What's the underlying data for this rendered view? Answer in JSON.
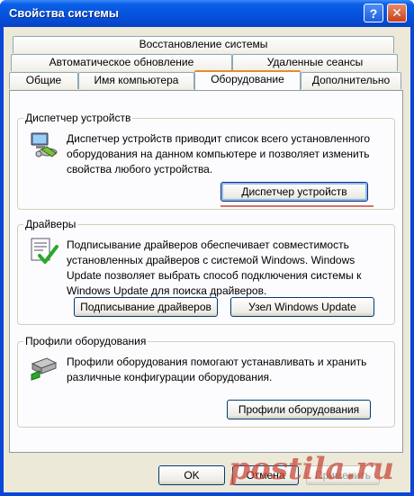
{
  "window": {
    "title": "Свойства системы",
    "help_glyph": "?",
    "close_glyph": "✕"
  },
  "tabs": {
    "row1": [
      "Восстановление системы"
    ],
    "row2": [
      "Автоматическое обновление",
      "Удаленные сеансы"
    ],
    "row3": [
      "Общие",
      "Имя компьютера",
      "Оборудование",
      "Дополнительно"
    ],
    "active": "Оборудование"
  },
  "device_manager": {
    "title": "Диспетчер устройств",
    "description": "Диспетчер устройств приводит список всего установленного оборудования на данном компьютере и позволяет изменить свойства любого устройства.",
    "button": "Диспетчер устройств",
    "icon": "device-manager-icon"
  },
  "drivers": {
    "title": "Драйверы",
    "description": "Подписывание драйверов обеспечивает совместимость установленных драйверов с системой Windows.  Windows Update позволяет выбрать способ подключения системы к Windows Update для поиска драйверов.",
    "signing_button": "Подписывание драйверов",
    "update_button": "Узел Windows Update",
    "icon": "driver-signing-icon"
  },
  "profiles": {
    "title": "Профили оборудования",
    "description": "Профили оборудования помогают устанавливать и хранить различные конфигурации оборудования.",
    "button": "Профили оборудования",
    "icon": "hardware-profile-icon"
  },
  "footer": {
    "ok": "OK",
    "cancel": "Отмена",
    "apply": "Применить"
  },
  "watermark": "postila.ru",
  "colors": {
    "titlebar": "#0650dc",
    "tab_accent": "#e68b2c",
    "face": "#ece9d8",
    "button_border": "#003c74"
  }
}
